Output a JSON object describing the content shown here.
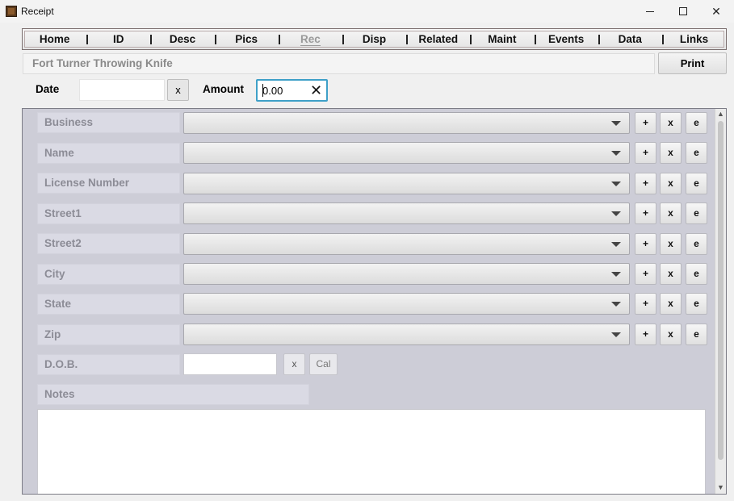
{
  "window": {
    "title": "Receipt",
    "icon": "app-icon"
  },
  "nav": {
    "items": [
      {
        "label": "Home"
      },
      {
        "label": "ID"
      },
      {
        "label": "Desc"
      },
      {
        "label": "Pics"
      },
      {
        "label": "Rec",
        "disabled": true
      },
      {
        "label": "Disp"
      },
      {
        "label": "Related"
      },
      {
        "label": "Maint"
      },
      {
        "label": "Events"
      },
      {
        "label": "Data"
      },
      {
        "label": "Links"
      }
    ]
  },
  "header": {
    "item_title": "Fort Turner Throwing Knife",
    "print_label": "Print"
  },
  "top_fields": {
    "date_label": "Date",
    "date_value": "",
    "date_clear": "x",
    "amount_label": "Amount",
    "amount_value": "0.00",
    "amount_clear": "✕"
  },
  "form": {
    "fields": [
      {
        "label": "Business",
        "value": ""
      },
      {
        "label": "Name",
        "value": ""
      },
      {
        "label": "License Number",
        "value": ""
      },
      {
        "label": "Street1",
        "value": ""
      },
      {
        "label": "Street2",
        "value": ""
      },
      {
        "label": "City",
        "value": ""
      },
      {
        "label": "State",
        "value": ""
      },
      {
        "label": "Zip",
        "value": ""
      }
    ],
    "add_label": "+",
    "clear_label": "x",
    "edit_label": "e",
    "dob_label": "D.O.B.",
    "dob_value": "",
    "dob_clear": "x",
    "dob_cal": "Cal",
    "notes_label": "Notes",
    "notes_value": ""
  }
}
